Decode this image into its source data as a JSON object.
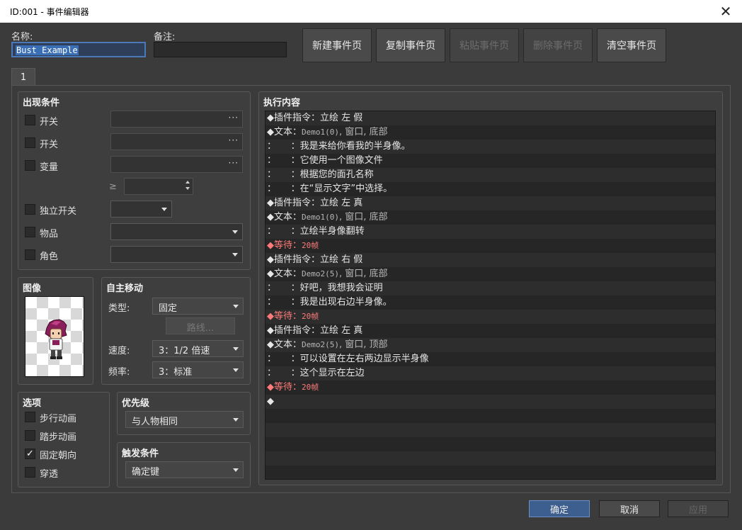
{
  "window": {
    "title": "ID:001 - 事件编辑器",
    "close": "✕"
  },
  "header": {
    "name_label": "名称:",
    "name_value": "Bust Example",
    "note_label": "备注:",
    "note_value": "",
    "page_buttons": [
      "新建事件页",
      "复制事件页",
      "粘贴事件页",
      "删除事件页",
      "清空事件页"
    ]
  },
  "tabs": [
    "1"
  ],
  "conditions": {
    "title": "出现条件",
    "switch1": "开关",
    "switch2": "开关",
    "variable": "变量",
    "gte": "≥",
    "self_switch": "独立开关",
    "item": "物品",
    "actor": "角色",
    "dots": "···"
  },
  "image": {
    "title": "图像"
  },
  "movement": {
    "title": "自主移动",
    "type_label": "类型:",
    "type_value": "固定",
    "route_button": "路线...",
    "speed_label": "速度:",
    "speed_value": "3：1/2 倍速",
    "freq_label": "频率:",
    "freq_value": "3：标准"
  },
  "options": {
    "title": "选项",
    "walking": "步行动画",
    "stepping": "踏步动画",
    "direction_fix": "固定朝向",
    "through": "穿透"
  },
  "priority": {
    "title": "优先级",
    "value": "与人物相同"
  },
  "trigger": {
    "title": "触发条件",
    "value": "确定键"
  },
  "contents": {
    "title": "执行内容",
    "rows": [
      "◆插件指令：立绘 左 假",
      "◆文本：",
      "：     ：我是来给你看我的半身像。",
      "：     ：它使用一个图像文件",
      "：     ：根据您的面孔名称",
      "：     ：在“显示文字”中选择。",
      "◆插件指令：立绘 左 真",
      "◆文本：",
      "：     ：立绘半身像翻转",
      "◆等待：",
      "◆插件指令：立绘 右 假",
      "◆文本：",
      "：     ：好吧，我想我会证明",
      "：     ：我是出现右边半身像。",
      "◆等待：",
      "◆插件指令：立绘 左 真",
      "◆文本：",
      "：     ：可以设置在左右两边显示半身像",
      "：     ：这个显示在左边",
      "◆等待：",
      "◆"
    ],
    "text_params": {
      "r1": "Demo1(0)",
      "r1b": ", 窗口, 底部",
      "r7": "Demo1(0)",
      "r7b": ", 窗口, 底部",
      "r11": "Demo2(5)",
      "r11b": ", 窗口, 底部",
      "r16": "Demo2(5)",
      "r16b": ", 窗口, 顶部"
    },
    "wait_frames": "20帧"
  },
  "footer": {
    "ok": "确定",
    "cancel": "取消",
    "apply": "应用"
  }
}
